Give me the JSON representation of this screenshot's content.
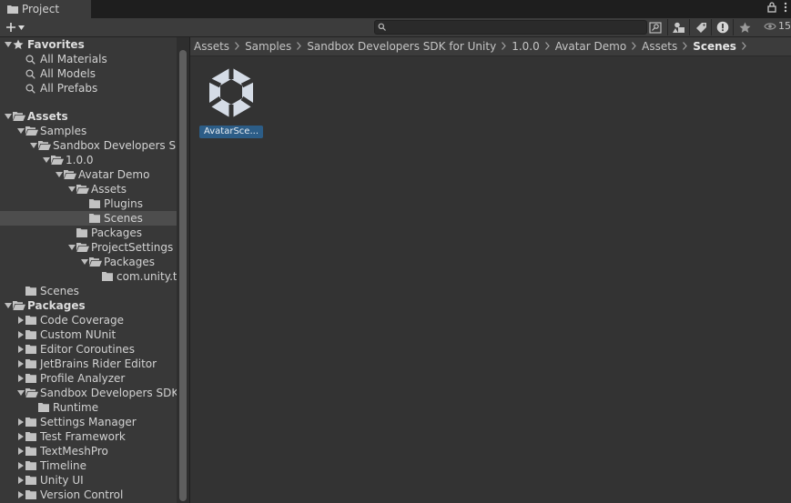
{
  "window": {
    "tab_title": "Project",
    "hidden_count": "15"
  },
  "toolbar": {
    "search_placeholder": ""
  },
  "tree": [
    {
      "label": "Favorites",
      "depth": 0,
      "arrow": "down",
      "icon": "star",
      "header": true
    },
    {
      "label": "All Materials",
      "depth": 1,
      "arrow": "none",
      "icon": "search"
    },
    {
      "label": "All Models",
      "depth": 1,
      "arrow": "none",
      "icon": "search"
    },
    {
      "label": "All Prefabs",
      "depth": 1,
      "arrow": "none",
      "icon": "search"
    },
    {
      "label": "",
      "depth": 0,
      "arrow": "none",
      "icon": "none",
      "spacer": true
    },
    {
      "label": "Assets",
      "depth": 0,
      "arrow": "down",
      "icon": "folder-open",
      "header": true
    },
    {
      "label": "Samples",
      "depth": 1,
      "arrow": "down",
      "icon": "folder-open"
    },
    {
      "label": "Sandbox Developers SDK for Unity",
      "depth": 2,
      "arrow": "down",
      "icon": "folder-open"
    },
    {
      "label": "1.0.0",
      "depth": 3,
      "arrow": "down",
      "icon": "folder-open"
    },
    {
      "label": "Avatar Demo",
      "depth": 4,
      "arrow": "down",
      "icon": "folder-open"
    },
    {
      "label": "Assets",
      "depth": 5,
      "arrow": "down",
      "icon": "folder-open"
    },
    {
      "label": "Plugins",
      "depth": 6,
      "arrow": "none",
      "icon": "folder"
    },
    {
      "label": "Scenes",
      "depth": 6,
      "arrow": "none",
      "icon": "folder",
      "selected": true
    },
    {
      "label": "Packages",
      "depth": 5,
      "arrow": "none",
      "icon": "folder"
    },
    {
      "label": "ProjectSettings",
      "depth": 5,
      "arrow": "down",
      "icon": "folder-open"
    },
    {
      "label": "Packages",
      "depth": 6,
      "arrow": "down",
      "icon": "folder-open"
    },
    {
      "label": "com.unity.toolchain",
      "depth": 7,
      "arrow": "none",
      "icon": "folder"
    },
    {
      "label": "Scenes",
      "depth": 1,
      "arrow": "none",
      "icon": "folder"
    },
    {
      "label": "Packages",
      "depth": 0,
      "arrow": "down",
      "icon": "folder-open",
      "header": true
    },
    {
      "label": "Code Coverage",
      "depth": 1,
      "arrow": "right",
      "icon": "folder"
    },
    {
      "label": "Custom NUnit",
      "depth": 1,
      "arrow": "right",
      "icon": "folder"
    },
    {
      "label": "Editor Coroutines",
      "depth": 1,
      "arrow": "right",
      "icon": "folder"
    },
    {
      "label": "JetBrains Rider Editor",
      "depth": 1,
      "arrow": "right",
      "icon": "folder"
    },
    {
      "label": "Profile Analyzer",
      "depth": 1,
      "arrow": "right",
      "icon": "folder"
    },
    {
      "label": "Sandbox Developers SDK for Unity",
      "depth": 1,
      "arrow": "down",
      "icon": "folder-open"
    },
    {
      "label": "Runtime",
      "depth": 2,
      "arrow": "none",
      "icon": "folder"
    },
    {
      "label": "Settings Manager",
      "depth": 1,
      "arrow": "right",
      "icon": "folder"
    },
    {
      "label": "Test Framework",
      "depth": 1,
      "arrow": "right",
      "icon": "folder"
    },
    {
      "label": "TextMeshPro",
      "depth": 1,
      "arrow": "right",
      "icon": "folder"
    },
    {
      "label": "Timeline",
      "depth": 1,
      "arrow": "right",
      "icon": "folder"
    },
    {
      "label": "Unity UI",
      "depth": 1,
      "arrow": "right",
      "icon": "folder"
    },
    {
      "label": "Version Control",
      "depth": 1,
      "arrow": "right",
      "icon": "folder"
    }
  ],
  "breadcrumb": [
    "Assets",
    "Samples",
    "Sandbox Developers SDK for Unity",
    "1.0.0",
    "Avatar Demo",
    "Assets",
    "Scenes"
  ],
  "assets": [
    {
      "name": "AvatarSce...",
      "icon": "unity-scene-icon"
    }
  ]
}
